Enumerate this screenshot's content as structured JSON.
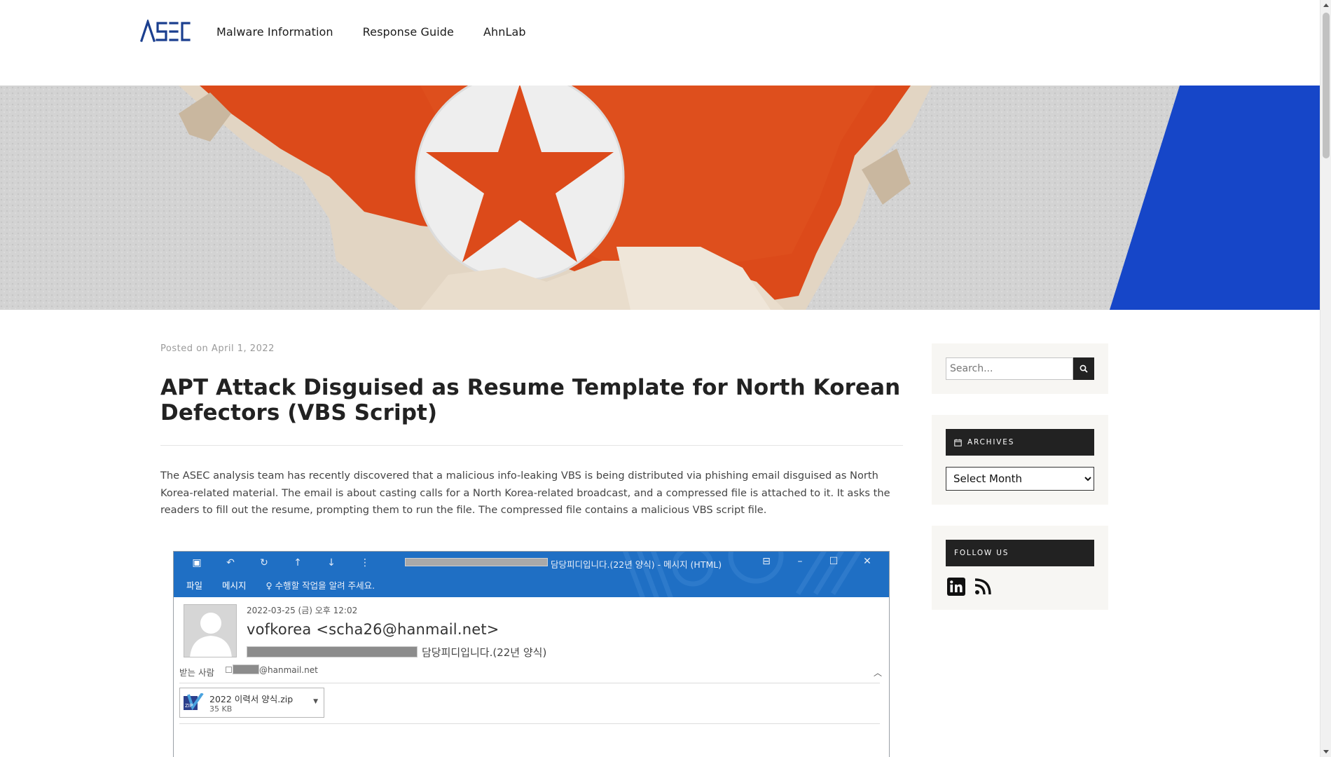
{
  "header": {
    "logo_text": "ASEC",
    "nav": [
      {
        "label": "Malware Information"
      },
      {
        "label": "Response Guide"
      },
      {
        "label": "AhnLab"
      }
    ]
  },
  "post": {
    "posted_prefix": "Posted on",
    "posted_date": "April 1, 2022",
    "title": "APT Attack Disguised as Resume Template for North Korean Defectors (VBS Script)",
    "body": "The ASEC analysis team has recently discovered that a malicious info-leaking VBS is being distributed via phishing email disguised as North Korea-related material. The email is about casting calls for a North Korea-related broadcast, and a compressed file is attached to it. It asks the readers to fill out the resume, prompting them to run the file. The compressed file contains a malicious VBS script file."
  },
  "email_screenshot": {
    "window_title": "담당피디입니다.(22년 양식) - 메시지 (HTML)",
    "ribbon": {
      "file_tab": "파일",
      "message_tab": "메시지",
      "tell_me": "수행할 작업을 알려 주세요."
    },
    "date": "2022-03-25 (금) 오후 12:02",
    "from": "vofkorea <scha26@hanmail.net>",
    "subject": "담당피디입니다.(22년 양식)",
    "to_label": "받는 사람",
    "to_domain": "@hanmail.net",
    "attachment": {
      "name": "2022 이력서 양식.zip",
      "size": "35 KB"
    }
  },
  "sidebar": {
    "search_placeholder": "Search...",
    "archives_heading": "ARCHIVES",
    "archives_select": "Select Month",
    "follow_heading": "FOLLOW US",
    "social": [
      "linkedin-icon",
      "rss-icon"
    ]
  },
  "colors": {
    "brand_blue": "#1b3f8f",
    "hero_blue": "#1646c8",
    "outlook_blue": "#1f6fc4",
    "widget_dark": "#222222"
  }
}
